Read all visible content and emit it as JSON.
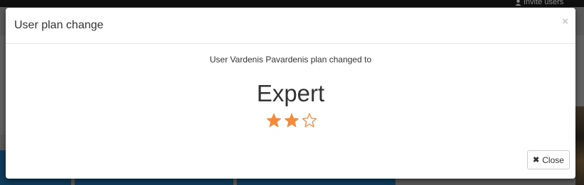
{
  "background": {
    "top_bar": {
      "invite_label": "Invite users"
    }
  },
  "modal": {
    "title": "User plan change",
    "close_icon": "close-icon",
    "message": "User Vardenis Pavardenis plan changed to",
    "plan": {
      "name": "Expert",
      "rating": {
        "filled": 2,
        "total": 3,
        "color": "#f58a3b"
      }
    },
    "footer": {
      "close_button_icon": "times-icon",
      "close_button_label": "Close"
    }
  }
}
